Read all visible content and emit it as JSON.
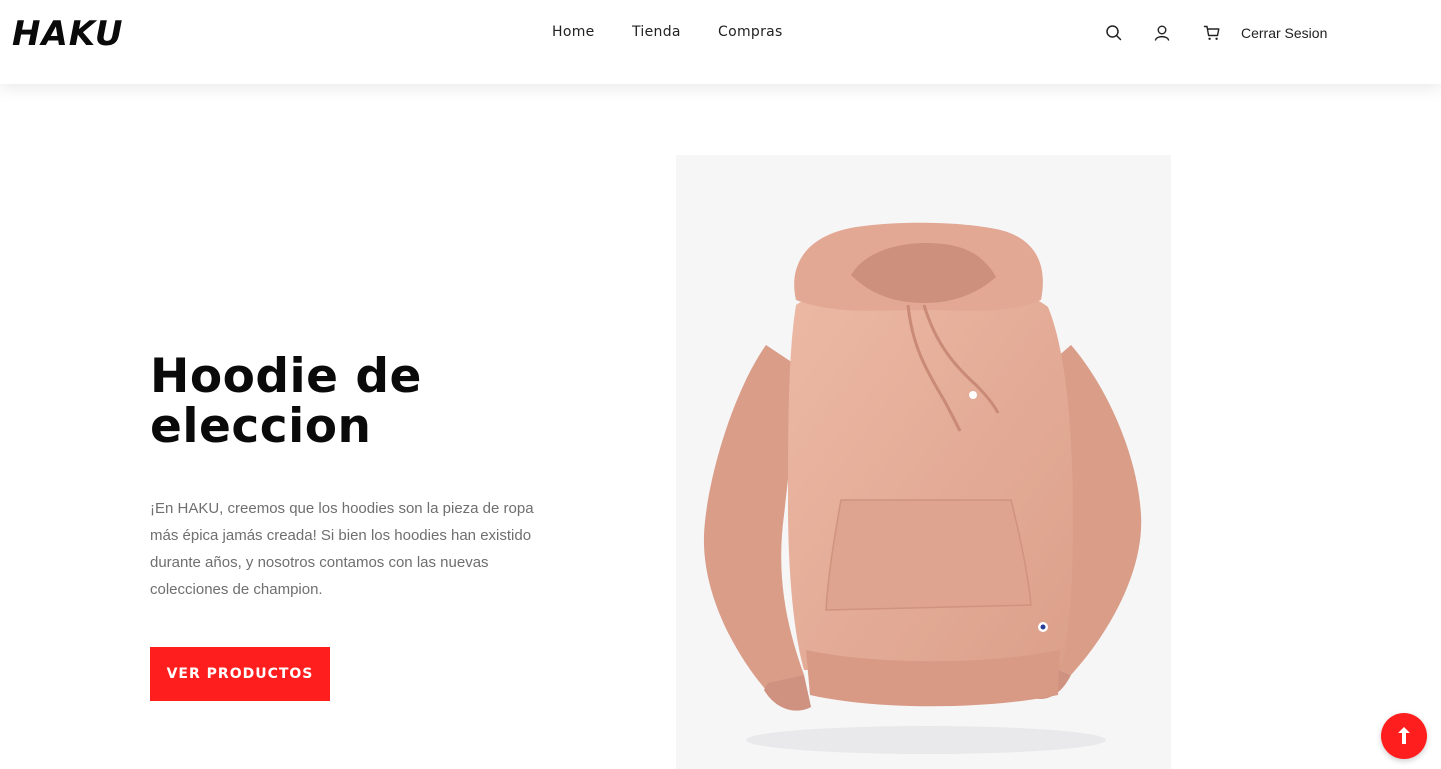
{
  "brand": {
    "logo_text": "HAKU"
  },
  "nav": {
    "items": [
      {
        "label": "Home"
      },
      {
        "label": "Tienda"
      },
      {
        "label": "Compras"
      }
    ]
  },
  "header_actions": {
    "icons": [
      "search-icon",
      "user-icon",
      "cart-icon"
    ],
    "logout_label": "Cerrar Sesion"
  },
  "hero": {
    "title_line1": "Hoodie de",
    "title_line2": "eleccion",
    "description": "¡En HAKU, creemos que los hoodies son la pieza de ropa más épica jamás creada! Si bien los hoodies han existido durante años, y nosotros contamos con las nuevas colecciones de champion.",
    "cta_label": "VER PRODUCTOS",
    "image": "pink-hoodie"
  },
  "colors": {
    "accent": "#ff1e1e",
    "hoodie": "#e5ad97",
    "text_dark": "#0a0a0a",
    "text_muted": "#6f6f6f"
  },
  "floating": {
    "icon": "arrow-up-icon"
  }
}
